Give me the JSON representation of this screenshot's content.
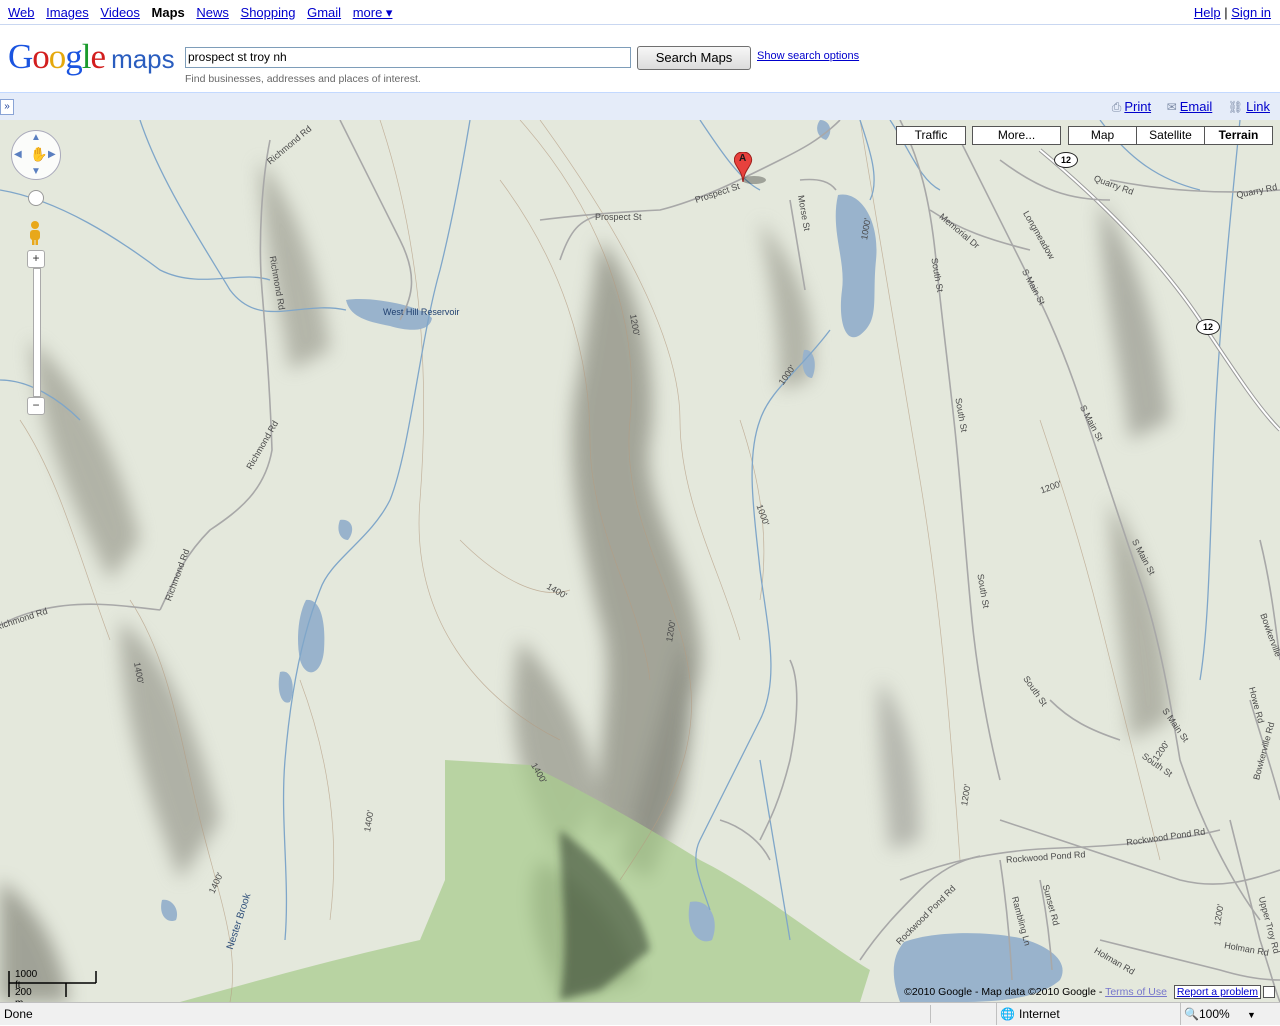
{
  "nav": {
    "links": [
      "Web",
      "Images",
      "Videos",
      "Maps",
      "News",
      "Shopping",
      "Gmail",
      "more ▾"
    ],
    "help": "Help",
    "signin": "Sign in"
  },
  "header": {
    "search_value": "prospect st troy nh",
    "search_button": "Search Maps",
    "show_options": "Show search options",
    "hint": "Find businesses, addresses and places of interest."
  },
  "toolbar": {
    "collapse": "»",
    "print": "Print",
    "email": "Email",
    "link": "Link"
  },
  "map_types": {
    "traffic": "Traffic",
    "more": "More...",
    "map": "Map",
    "satellite": "Satellite",
    "terrain": "Terrain",
    "selected": "Terrain"
  },
  "marker": {
    "label": "A"
  },
  "route_shields": [
    "12",
    "12"
  ],
  "map_labels": {
    "richmond_rd": "Richmond Rd",
    "prospect_st": "Prospect St",
    "morse_st": "Morse St",
    "memorial_dr": "Memorial Dr",
    "longmeadow": "Longmeadow",
    "south_st": "South St",
    "s_main_st": "S Main St",
    "quarry_rd": "Quarry Rd",
    "west_hill_reservoir": "West Hill Reservoir",
    "c1000": "1000'",
    "c1200": "1200'",
    "c1400": "1400'",
    "nester_brook": "Nester Brook",
    "rockwood_pond_rd": "Rockwood Pond Rd",
    "sunset_rd": "Sunset Rd",
    "rambling_ln": "Rambling Ln",
    "holman_rd": "Holman Rd",
    "upper_troy_rd": "Upper Troy Rd",
    "bowkerville_rd": "Bowkerville Rd",
    "howe_rd": "Howe Rd",
    "bowkerville": "Bowkerville"
  },
  "scale": {
    "feet": "1000 ft",
    "meters": "200 m"
  },
  "copyright": {
    "text": "©2010 Google - Map data ©2010 Google - ",
    "terms": "Terms of Use",
    "report": "Report a problem"
  },
  "status": {
    "left": "Done",
    "zone": "Internet",
    "zoom": "100%"
  },
  "colors": {
    "water": "#99b3cc",
    "park": "#b4d69d",
    "terrain": "#e4e8dc"
  }
}
